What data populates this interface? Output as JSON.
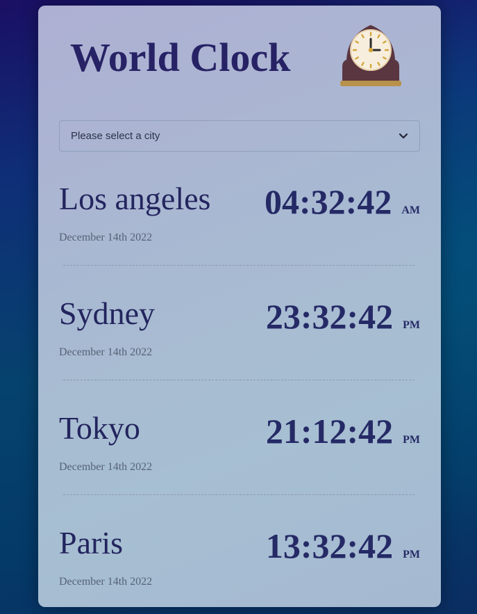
{
  "header": {
    "title": "World Clock",
    "icon": "mantel-clock-icon"
  },
  "select": {
    "selected": "Please select a city",
    "icon": "chevron-down-icon"
  },
  "colors": {
    "title": "#272265",
    "time": "#252a66",
    "clock_body": "#5a3640",
    "clock_base": "#b8914a"
  },
  "cities": [
    {
      "name": "Los angeles",
      "date": "December 14th 2022",
      "time": "04:32:42",
      "ampm": "AM"
    },
    {
      "name": "Sydney",
      "date": "December 14th 2022",
      "time": "23:32:42",
      "ampm": "PM"
    },
    {
      "name": "Tokyo",
      "date": "December 14th 2022",
      "time": "21:12:42",
      "ampm": "PM"
    },
    {
      "name": "Paris",
      "date": "December 14th 2022",
      "time": "13:32:42",
      "ampm": "PM"
    }
  ]
}
